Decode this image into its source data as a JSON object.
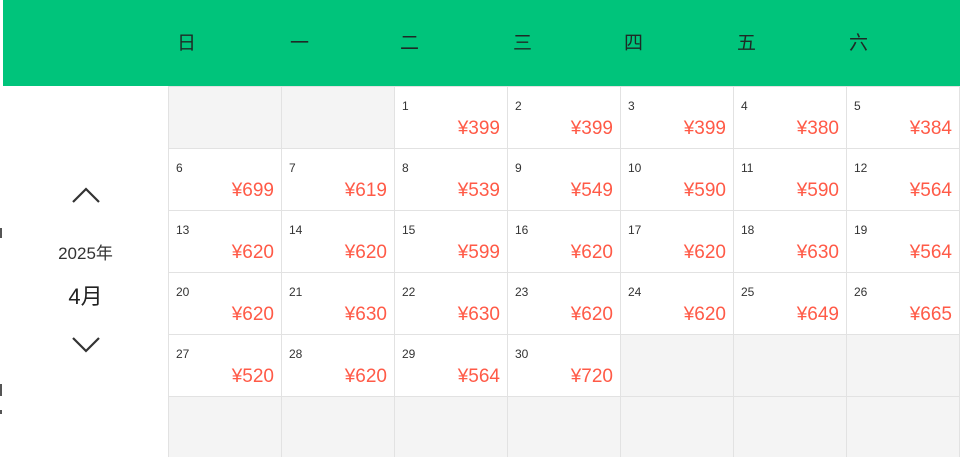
{
  "colors": {
    "header_bg": "#00c47b",
    "price": "#ff5a47",
    "empty_cell": "#f4f4f4"
  },
  "weekdays": [
    "日",
    "一",
    "二",
    "三",
    "四",
    "五",
    "六"
  ],
  "panel": {
    "year": "2025年",
    "month": "4月",
    "prev_icon": "chevron-up-icon",
    "next_icon": "chevron-down-icon"
  },
  "days": [
    {
      "day": "1",
      "price": "¥399"
    },
    {
      "day": "2",
      "price": "¥399"
    },
    {
      "day": "3",
      "price": "¥399"
    },
    {
      "day": "4",
      "price": "¥380"
    },
    {
      "day": "5",
      "price": "¥384"
    },
    {
      "day": "6",
      "price": "¥699"
    },
    {
      "day": "7",
      "price": "¥619"
    },
    {
      "day": "8",
      "price": "¥539"
    },
    {
      "day": "9",
      "price": "¥549"
    },
    {
      "day": "10",
      "price": "¥590"
    },
    {
      "day": "11",
      "price": "¥590"
    },
    {
      "day": "12",
      "price": "¥564"
    },
    {
      "day": "13",
      "price": "¥620"
    },
    {
      "day": "14",
      "price": "¥620"
    },
    {
      "day": "15",
      "price": "¥599"
    },
    {
      "day": "16",
      "price": "¥620"
    },
    {
      "day": "17",
      "price": "¥620"
    },
    {
      "day": "18",
      "price": "¥630"
    },
    {
      "day": "19",
      "price": "¥564"
    },
    {
      "day": "20",
      "price": "¥620"
    },
    {
      "day": "21",
      "price": "¥630"
    },
    {
      "day": "22",
      "price": "¥630"
    },
    {
      "day": "23",
      "price": "¥620"
    },
    {
      "day": "24",
      "price": "¥620"
    },
    {
      "day": "25",
      "price": "¥649"
    },
    {
      "day": "26",
      "price": "¥665"
    },
    {
      "day": "27",
      "price": "¥520"
    },
    {
      "day": "28",
      "price": "¥620"
    },
    {
      "day": "29",
      "price": "¥564"
    },
    {
      "day": "30",
      "price": "¥720"
    }
  ]
}
